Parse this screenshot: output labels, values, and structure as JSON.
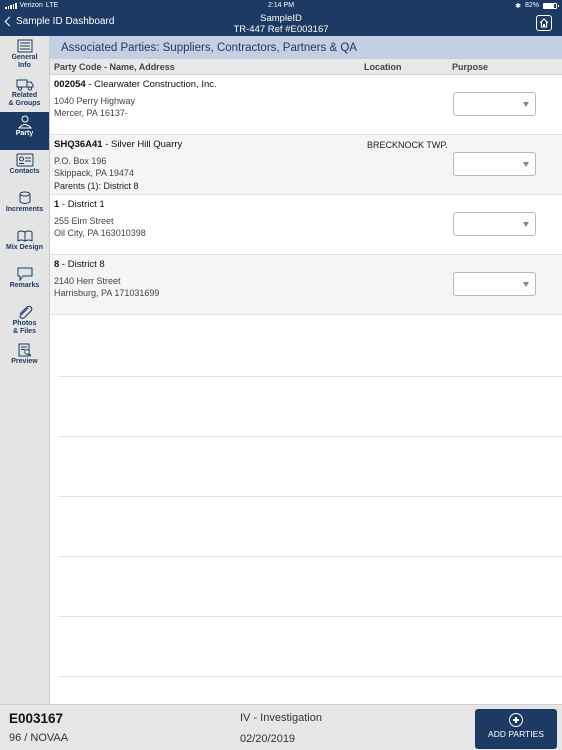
{
  "status_bar": {
    "carrier": "Verizon",
    "network": "LTE",
    "time": "2:14 PM",
    "battery": "82%"
  },
  "nav": {
    "back_label": "Sample ID Dashboard",
    "title": "SampleID",
    "subtitle": "TR-447 Ref #E003167"
  },
  "sidebar": {
    "items": [
      {
        "label": "General\nInfo",
        "icon": "list-icon",
        "active": false
      },
      {
        "label": "Related\n& Groups",
        "icon": "truck-icon",
        "active": false
      },
      {
        "label": "Party",
        "icon": "person-icon",
        "active": true
      },
      {
        "label": "Contacts",
        "icon": "contact-card-icon",
        "active": false
      },
      {
        "label": "Increments",
        "icon": "cylinder-icon",
        "active": false
      },
      {
        "label": "Mix Design",
        "icon": "book-icon",
        "active": false
      },
      {
        "label": "Remarks",
        "icon": "speech-bubble-icon",
        "active": false
      },
      {
        "label": "Photos\n& Files",
        "icon": "paperclip-icon",
        "active": false
      },
      {
        "label": "Preview",
        "icon": "document-search-icon",
        "active": false
      }
    ]
  },
  "main": {
    "section_title": "Associated Parties: Suppliers, Contractors, Partners & QA",
    "columns": {
      "party": "Party Code - Name, Address",
      "location": "Location",
      "purpose": "Purpose"
    },
    "parties": [
      {
        "code": "002054",
        "name": " - Clearwater Construction, Inc.",
        "address1": "1040 Perry Highway",
        "address2": "Mercer, PA 16137-",
        "parents": "",
        "location": ""
      },
      {
        "code": "SHQ36A41",
        "name": " - Silver Hill Quarry",
        "address1": "P.O. Box 196",
        "address2": "Skippack, PA 19474",
        "parents": "Parents (1): District 8",
        "location": "BRECKNOCK TWP."
      },
      {
        "code": "1",
        "name": " - District 1",
        "address1": "255 Elm Street",
        "address2": "Oil City, PA 163010398",
        "parents": "",
        "location": ""
      },
      {
        "code": "8",
        "name": " - District 8",
        "address1": "2140 Herr Street",
        "address2": "Harrisburg, PA 171031699",
        "parents": "",
        "location": ""
      }
    ]
  },
  "footer": {
    "sample_id": "E003167",
    "sub": "96 / NOVAA",
    "type": "IV - Investigation",
    "date": "02/20/2019",
    "add_button_label": "ADD PARTIES"
  },
  "colors": {
    "nav_bg": "#1c3a64",
    "section_header_bg": "#c3d0e4",
    "sidebar_bg": "#e4e4e4"
  }
}
